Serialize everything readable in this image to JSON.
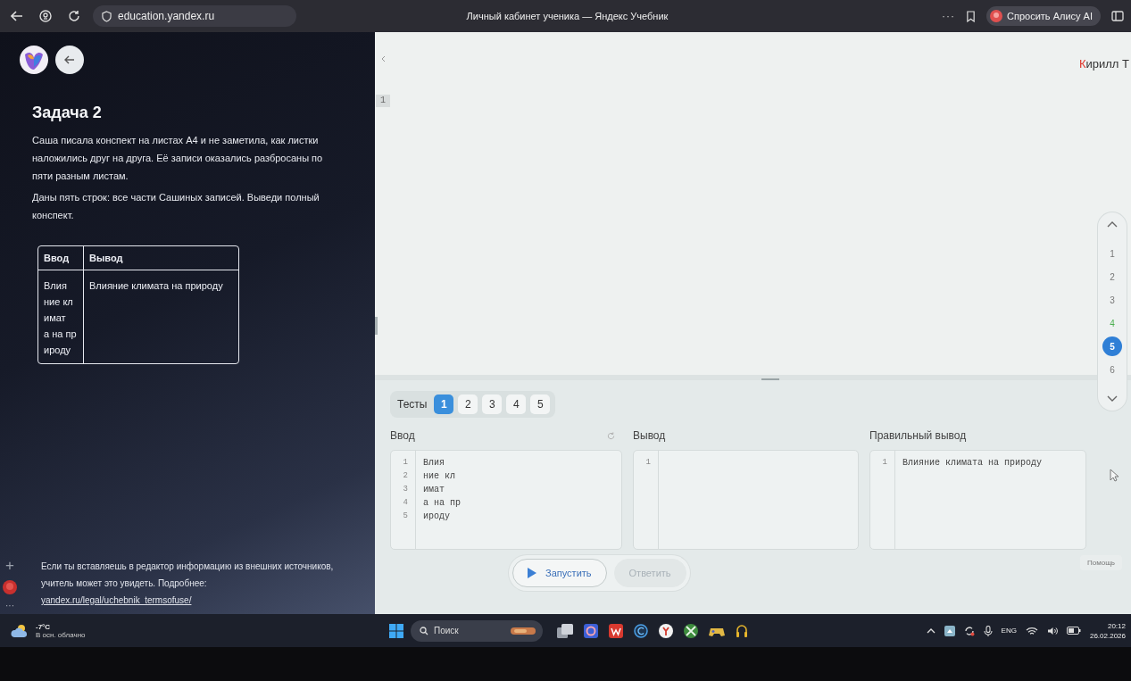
{
  "browser": {
    "address": "education.yandex.ru",
    "title": "Личный кабинет ученика — Яндекс Учебник",
    "menu": "···",
    "assistant_button": "Спросить Алису AI"
  },
  "browser_sidebar": {
    "add": "+",
    "more": "···"
  },
  "task": {
    "title": "Задача 2",
    "paragraphs": [
      "Саша писала конспект на листах А4 и не заметила, как листки наложились друг на друга. Её записи оказались разбросаны по пяти разным листам.",
      "Даны пять строк: все части Сашиных записей. Выведи полный конспект."
    ],
    "example_table": {
      "columns": [
        "Ввод",
        "Вывод"
      ],
      "rows": [
        {
          "input": [
            "Влия",
            "ние кл",
            "имат",
            "а на пр",
            "ироду"
          ],
          "output": "Влияние климата на природу"
        }
      ]
    },
    "notice": "Если ты вставляешь в редактор информацию из внешних источников, учитель может это увидеть. Подробнее:",
    "notice_link": "yandex.ru/legal/uchebnik_termsofuse/"
  },
  "editor": {
    "user": "Кирилл Т",
    "line_numbers": [
      "1"
    ]
  },
  "task_nav": [
    {
      "label": "1",
      "selected": false,
      "solved": false
    },
    {
      "label": "2",
      "selected": false,
      "solved": false
    },
    {
      "label": "3",
      "selected": false,
      "solved": false
    },
    {
      "label": "4",
      "selected": false,
      "solved": true
    },
    {
      "label": "5",
      "selected": true,
      "solved": false
    },
    {
      "label": "6",
      "selected": false,
      "solved": false
    }
  ],
  "tests": {
    "label": "Тесты",
    "tabs": [
      {
        "label": "1",
        "selected": true
      },
      {
        "label": "2",
        "selected": false
      },
      {
        "label": "3",
        "selected": false
      },
      {
        "label": "4",
        "selected": false
      },
      {
        "label": "5",
        "selected": false
      }
    ],
    "panes": [
      {
        "title": "Ввод",
        "kind": "input",
        "lines": [
          {
            "number": "1",
            "text": "Влия"
          },
          {
            "number": "2",
            "text": "ние кл"
          },
          {
            "number": "3",
            "text": "имат"
          },
          {
            "number": "4",
            "text": "а на пр"
          },
          {
            "number": "5",
            "text": "ироду"
          }
        ]
      },
      {
        "title": "Вывод",
        "kind": "output",
        "lines": [
          {
            "number": "1"
          }
        ]
      },
      {
        "title": "Правильный вывод",
        "kind": "expected",
        "lines": [
          {
            "number": "1",
            "text": "Влияние климата на природу"
          }
        ]
      }
    ]
  },
  "help_button": "Помощь",
  "actions": [
    {
      "label": "Запустить",
      "kind": "run",
      "disabled": false
    },
    {
      "label": "Ответить",
      "kind": "submit",
      "disabled": true
    }
  ],
  "taskbar": {
    "temperature": "-7°C",
    "weather": "В осн. облачно",
    "search": {
      "placeholder": "Поиск"
    },
    "language": "ENG",
    "time": "20:12",
    "date": "26.02.2026"
  }
}
